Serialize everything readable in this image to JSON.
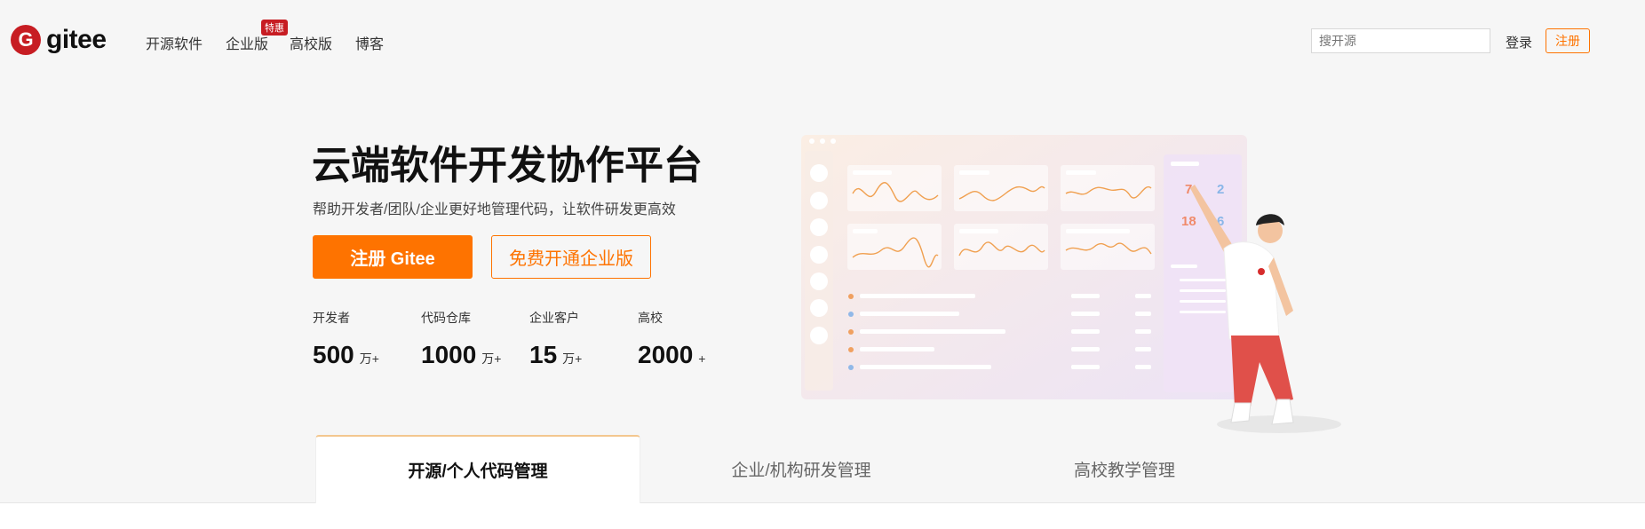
{
  "brand": {
    "logo_glyph": "G",
    "name": "gitee",
    "color": "#c71d23"
  },
  "nav": [
    {
      "label": "开源软件"
    },
    {
      "label": "企业版",
      "badge": "特惠"
    },
    {
      "label": "高校版"
    },
    {
      "label": "博客"
    }
  ],
  "header": {
    "search_placeholder": "搜开源",
    "login_label": "登录",
    "signup_label": "注册"
  },
  "hero": {
    "title": "云端软件开发协作平台",
    "subtitle": "帮助开发者/团队/企业更好地管理代码，让软件研发更高效",
    "primary_button": "注册 Gitee",
    "secondary_button": "免费开通企业版",
    "accent_color": "#fe7300"
  },
  "stats": [
    {
      "label": "开发者",
      "value": "500",
      "unit": "万+"
    },
    {
      "label": "代码仓库",
      "value": "1000",
      "unit": "万+"
    },
    {
      "label": "企业客户",
      "value": "15",
      "unit": "万+"
    },
    {
      "label": "高校",
      "value": "2000",
      "unit": "+"
    }
  ],
  "illustration": {
    "calendar_numbers": [
      "7",
      "2",
      "18",
      "6"
    ]
  },
  "tabs": [
    {
      "label": "开源/个人代码管理",
      "active": true
    },
    {
      "label": "企业/机构研发管理",
      "active": false
    },
    {
      "label": "高校教学管理",
      "active": false
    }
  ]
}
